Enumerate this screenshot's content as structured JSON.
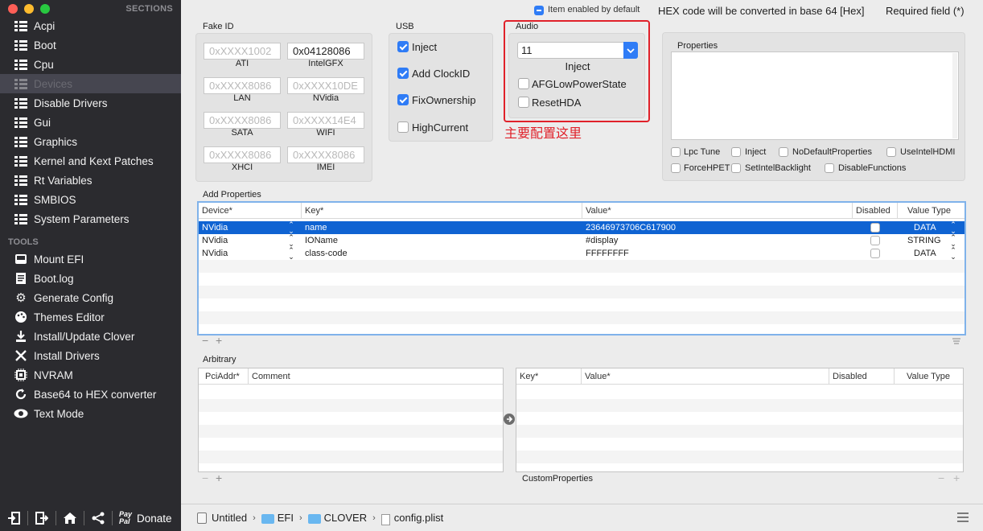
{
  "sidebar": {
    "sections_title": "SECTIONS",
    "items": [
      {
        "label": "Acpi",
        "icon": "list-icon"
      },
      {
        "label": "Boot",
        "icon": "list-icon"
      },
      {
        "label": "Cpu",
        "icon": "list-icon"
      },
      {
        "label": "Devices",
        "icon": "list-icon",
        "selected": true
      },
      {
        "label": "Disable Drivers",
        "icon": "list-icon"
      },
      {
        "label": "Gui",
        "icon": "list-icon"
      },
      {
        "label": "Graphics",
        "icon": "list-icon"
      },
      {
        "label": "Kernel and Kext Patches",
        "icon": "list-icon"
      },
      {
        "label": "Rt Variables",
        "icon": "list-icon"
      },
      {
        "label": "SMBIOS",
        "icon": "list-icon"
      },
      {
        "label": "System Parameters",
        "icon": "list-icon"
      }
    ],
    "tools_title": "TOOLS",
    "tools": [
      {
        "label": "Mount EFI",
        "icon": "disk-icon"
      },
      {
        "label": "Boot.log",
        "icon": "log-icon"
      },
      {
        "label": "Generate Config",
        "icon": "gear-icon"
      },
      {
        "label": "Themes Editor",
        "icon": "palette-icon"
      },
      {
        "label": "Install/Update Clover",
        "icon": "download-icon"
      },
      {
        "label": "Install Drivers",
        "icon": "wrench-icon"
      },
      {
        "label": "NVRAM",
        "icon": "chip-icon"
      },
      {
        "label": "Base64 to HEX converter",
        "icon": "refresh-icon"
      },
      {
        "label": "Text Mode",
        "icon": "eye-icon"
      }
    ],
    "bottom": {
      "donate_label": "Donate",
      "paypal_text": "Pay Pal"
    }
  },
  "topbar": {
    "item_enabled_label": "Item enabled by default",
    "hex_note": "HEX code will be converted in base 64 [Hex]",
    "required_note": "Required field (*)"
  },
  "fake_id": {
    "title": "Fake ID",
    "fields": [
      {
        "value": "0xXXXX1002",
        "label": "ATI",
        "filled": false
      },
      {
        "value": "0x04128086",
        "label": "IntelGFX",
        "filled": true
      },
      {
        "value": "0xXXXX8086",
        "label": "LAN",
        "filled": false
      },
      {
        "value": "0xXXXX10DE",
        "label": "NVidia",
        "filled": false
      },
      {
        "value": "0xXXXX8086",
        "label": "SATA",
        "filled": false
      },
      {
        "value": "0xXXXX14E4",
        "label": "WIFI",
        "filled": false
      },
      {
        "value": "0xXXXX8086",
        "label": "XHCI",
        "filled": false
      },
      {
        "value": "0xXXXX8086",
        "label": "IMEI",
        "filled": false
      }
    ]
  },
  "usb": {
    "title": "USB",
    "options": [
      {
        "label": "Inject",
        "checked": true
      },
      {
        "label": "Add ClockID",
        "checked": true
      },
      {
        "label": "FixOwnership",
        "checked": true
      },
      {
        "label": "HighCurrent",
        "checked": false
      }
    ]
  },
  "audio": {
    "title": "Audio",
    "inject_value": "11",
    "inject_label": "Inject",
    "options": [
      {
        "label": "AFGLowPowerState",
        "checked": false
      },
      {
        "label": "ResetHDA",
        "checked": false
      }
    ],
    "annotation": "主要配置这里",
    "annotation_color": "#e0212a"
  },
  "properties": {
    "title": "Properties",
    "options": [
      {
        "label": "Lpc Tune",
        "checked": false
      },
      {
        "label": "Inject",
        "checked": false
      },
      {
        "label": "NoDefaultProperties",
        "checked": false
      },
      {
        "label": "UseIntelHDMI",
        "checked": false
      },
      {
        "label": "ForceHPET",
        "checked": false
      },
      {
        "label": "SetIntelBacklight",
        "checked": false
      },
      {
        "label": "DisableFunctions",
        "checked": false
      }
    ]
  },
  "add_properties": {
    "title": "Add Properties",
    "columns": [
      "Device*",
      "Key*",
      "Value*",
      "Disabled",
      "Value Type"
    ],
    "rows": [
      {
        "device": "NVidia",
        "key": "name",
        "value": "23646973706C617900",
        "disabled": false,
        "type": "DATA",
        "selected": true
      },
      {
        "device": "NVidia",
        "key": "IOName",
        "value": "#display",
        "disabled": false,
        "type": "STRING",
        "selected": false
      },
      {
        "device": "NVidia",
        "key": "class-code",
        "value": "FFFFFFFF",
        "disabled": false,
        "type": "DATA",
        "selected": false
      }
    ]
  },
  "arbitrary": {
    "title": "Arbitrary",
    "left_columns": [
      "PciAddr*",
      "Comment"
    ],
    "right_columns": [
      "Key*",
      "Value*",
      "Disabled",
      "Value Type"
    ],
    "custom_label": "CustomProperties"
  },
  "pathbar": {
    "segments": [
      "Untitled",
      "EFI",
      "CLOVER",
      "config.plist"
    ]
  },
  "colors": {
    "accent": "#2f7cf6",
    "selection": "#0f63d2",
    "sidebar_bg": "#2b2b2f"
  }
}
